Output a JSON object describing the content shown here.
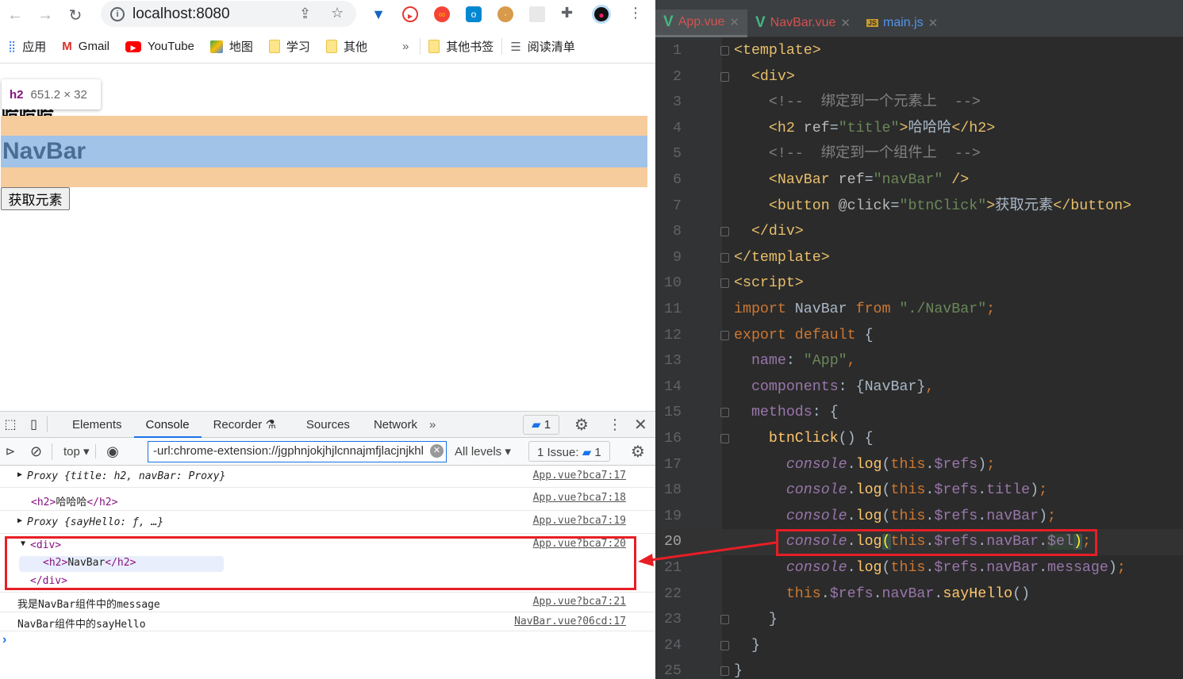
{
  "browser": {
    "url": "localhost:8080",
    "bookmarks": [
      {
        "label": "应用",
        "icon": "apps-grid-icon"
      },
      {
        "label": "Gmail",
        "icon": "gmail-icon"
      },
      {
        "label": "YouTube",
        "icon": "youtube-icon"
      },
      {
        "label": "地图",
        "icon": "maps-icon"
      },
      {
        "label": "学习",
        "icon": "folder-icon"
      },
      {
        "label": "其他",
        "icon": "folder-icon"
      }
    ],
    "overflow": "»",
    "other_bookmarks": "其他书签",
    "reading_list": "阅读清单"
  },
  "page": {
    "tooltip": {
      "tag": "h2",
      "size": "651.2 × 32"
    },
    "hidden_h2": "哈哈哈",
    "navbar_h2": "NavBar",
    "button": "获取元素"
  },
  "devtools": {
    "tabs": [
      "Elements",
      "Console",
      "Recorder",
      "Sources",
      "Network"
    ],
    "active_tab": "Console",
    "more": "»",
    "messages_badge": "1",
    "context": "top",
    "filter": "-url:chrome-extension://jgphnjokjhjlcnnajmfjlacjnjkhl",
    "levels": "All levels",
    "issues_label": "1 Issue:",
    "issues_count": "1",
    "console": [
      {
        "text": "Proxy {title: h2, navBar: Proxy}",
        "source": "App.vue?bca7:17"
      },
      {
        "text": "哈哈哈",
        "source": "App.vue?bca7:18"
      },
      {
        "text": "Proxy {sayHello: ƒ, …}",
        "source": "App.vue?bca7:19"
      },
      {
        "text": "NavBar",
        "source": "App.vue?bca7:20"
      },
      {
        "text": "我是NavBar组件中的message",
        "source": "App.vue?bca7:21"
      },
      {
        "text": "NavBar组件中的sayHello",
        "source": "NavBar.vue?06cd:17"
      }
    ],
    "prompt": "›"
  },
  "editor": {
    "tabs": [
      {
        "label": "App.vue",
        "color": "#d25252",
        "icon": "vue-icon"
      },
      {
        "label": "NavBar.vue",
        "color": "#d25252",
        "icon": "vue-icon"
      },
      {
        "label": "main.js",
        "color": "#5394ec",
        "icon": "js-file-icon"
      }
    ],
    "current_line": 20,
    "lines": [
      [
        [
          "<template>",
          "tag"
        ]
      ],
      [
        [
          "  ",
          "txt"
        ],
        [
          "<div>",
          "tag"
        ]
      ],
      [
        [
          "    ",
          "txt"
        ],
        [
          "<!--  绑定到一个元素上  -->",
          "com"
        ]
      ],
      [
        [
          "    ",
          "txt"
        ],
        [
          "<h2 ",
          "tag"
        ],
        [
          "ref",
          "attr"
        ],
        [
          "=",
          "txt"
        ],
        [
          "\"title\"",
          "str"
        ],
        [
          ">",
          "tag"
        ],
        [
          "哈哈哈",
          "txt"
        ],
        [
          "</h2>",
          "tag"
        ]
      ],
      [
        [
          "    ",
          "txt"
        ],
        [
          "<!--  绑定到一个组件上  -->",
          "com"
        ]
      ],
      [
        [
          "    ",
          "txt"
        ],
        [
          "<NavBar ",
          "tag"
        ],
        [
          "ref",
          "attr"
        ],
        [
          "=",
          "txt"
        ],
        [
          "\"navBar\"",
          "str"
        ],
        [
          " />",
          "tag"
        ]
      ],
      [
        [
          "    ",
          "txt"
        ],
        [
          "<button ",
          "tag"
        ],
        [
          "@click",
          "attr"
        ],
        [
          "=",
          "txt"
        ],
        [
          "\"btnClick\"",
          "str"
        ],
        [
          ">",
          "tag"
        ],
        [
          "获取元素",
          "txt"
        ],
        [
          "</button>",
          "tag"
        ]
      ],
      [
        [
          "  ",
          "txt"
        ],
        [
          "</div>",
          "tag"
        ]
      ],
      [
        [
          "</template>",
          "tag"
        ]
      ],
      [
        [
          "<script>",
          "tag"
        ]
      ],
      [
        [
          "import ",
          "kw"
        ],
        [
          "NavBar ",
          "txt"
        ],
        [
          "from ",
          "kw"
        ],
        [
          "\"./NavBar\"",
          "str"
        ],
        [
          ";",
          "kw"
        ]
      ],
      [
        [
          "export default ",
          "kw"
        ],
        [
          "{",
          "txt"
        ]
      ],
      [
        [
          "  ",
          "txt"
        ],
        [
          "name",
          "prop"
        ],
        [
          ": ",
          "txt"
        ],
        [
          "\"App\"",
          "str"
        ],
        [
          ",",
          "kw"
        ]
      ],
      [
        [
          "  ",
          "txt"
        ],
        [
          "components",
          "prop"
        ],
        [
          ": {NavBar}",
          "txt"
        ],
        [
          ",",
          "kw"
        ]
      ],
      [
        [
          "  ",
          "txt"
        ],
        [
          "methods",
          "prop"
        ],
        [
          ": {",
          "txt"
        ]
      ],
      [
        [
          "    ",
          "txt"
        ],
        [
          "btnClick",
          "fn"
        ],
        [
          "() {",
          "txt"
        ]
      ],
      [
        [
          "      ",
          "txt"
        ],
        [
          "console",
          "con"
        ],
        [
          ".",
          "txt"
        ],
        [
          "log",
          "fn"
        ],
        [
          "(",
          "txt"
        ],
        [
          "this",
          "kw"
        ],
        [
          ".",
          "txt"
        ],
        [
          "$refs",
          "prop"
        ],
        [
          ")",
          "txt"
        ],
        [
          ";",
          "kw"
        ]
      ],
      [
        [
          "      ",
          "txt"
        ],
        [
          "console",
          "con"
        ],
        [
          ".",
          "txt"
        ],
        [
          "log",
          "fn"
        ],
        [
          "(",
          "txt"
        ],
        [
          "this",
          "kw"
        ],
        [
          ".",
          "txt"
        ],
        [
          "$refs",
          "prop"
        ],
        [
          ".",
          "txt"
        ],
        [
          "title",
          "prop"
        ],
        [
          ")",
          "txt"
        ],
        [
          ";",
          "kw"
        ]
      ],
      [
        [
          "      ",
          "txt"
        ],
        [
          "console",
          "con"
        ],
        [
          ".",
          "txt"
        ],
        [
          "log",
          "fn"
        ],
        [
          "(",
          "txt"
        ],
        [
          "this",
          "kw"
        ],
        [
          ".",
          "txt"
        ],
        [
          "$refs",
          "prop"
        ],
        [
          ".",
          "txt"
        ],
        [
          "navBar",
          "prop"
        ],
        [
          ")",
          "txt"
        ],
        [
          ";",
          "kw"
        ]
      ],
      [
        [
          "      ",
          "txt"
        ],
        [
          "console",
          "con"
        ],
        [
          ".",
          "txt"
        ],
        [
          "log",
          "fn"
        ],
        [
          "(",
          "hl"
        ],
        [
          "this",
          "kw"
        ],
        [
          ".",
          "txt"
        ],
        [
          "$refs",
          "prop"
        ],
        [
          ".",
          "txt"
        ],
        [
          "navBar",
          "prop"
        ],
        [
          ".",
          "txt"
        ],
        [
          "$el",
          "el"
        ],
        [
          ")",
          "hl"
        ],
        [
          ";",
          "kw"
        ]
      ],
      [
        [
          "      ",
          "txt"
        ],
        [
          "console",
          "con"
        ],
        [
          ".",
          "txt"
        ],
        [
          "log",
          "fn"
        ],
        [
          "(",
          "txt"
        ],
        [
          "this",
          "kw"
        ],
        [
          ".",
          "txt"
        ],
        [
          "$refs",
          "prop"
        ],
        [
          ".",
          "txt"
        ],
        [
          "navBar",
          "prop"
        ],
        [
          ".",
          "txt"
        ],
        [
          "message",
          "prop"
        ],
        [
          ")",
          "txt"
        ],
        [
          ";",
          "kw"
        ]
      ],
      [
        [
          "      ",
          "txt"
        ],
        [
          "this",
          "kw"
        ],
        [
          ".",
          "txt"
        ],
        [
          "$refs",
          "prop"
        ],
        [
          ".",
          "txt"
        ],
        [
          "navBar",
          "prop"
        ],
        [
          ".",
          "txt"
        ],
        [
          "sayHello",
          "fn"
        ],
        [
          "()",
          "txt"
        ]
      ],
      [
        [
          "    }",
          "txt"
        ]
      ],
      [
        [
          "  }",
          "txt"
        ]
      ],
      [
        [
          "}",
          "txt"
        ]
      ]
    ]
  }
}
